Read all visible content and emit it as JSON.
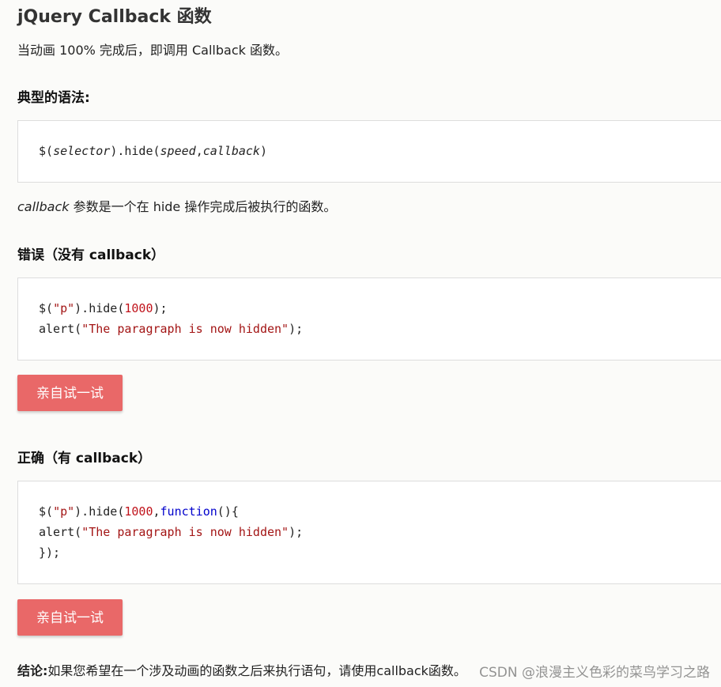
{
  "title": "jQuery Callback 函数",
  "intro": "当动画 100% 完成后，即调用 Callback 函数。",
  "syntax_heading": "典型的语法:",
  "syntax_code": {
    "prefix": "$(",
    "selector": "selector",
    "mid": ").hide(",
    "speed": "speed",
    "comma": ",",
    "callback": "callback",
    "suffix": ")"
  },
  "callback_desc": {
    "term": "callback",
    "rest": " 参数是一个在 hide 操作完成后被执行的函数。"
  },
  "wrong_heading": "错误（没有 callback）",
  "wrong_code": {
    "l1_a": "$(",
    "l1_str": "\"p\"",
    "l1_b": ").hide(",
    "l1_num": "1000",
    "l1_c": ");",
    "l2_a": "alert(",
    "l2_str": "\"The paragraph is now hidden\"",
    "l2_b": ");"
  },
  "try_button_1": "亲自试一试",
  "right_heading": "正确（有 callback）",
  "right_code": {
    "l1_a": "$(",
    "l1_str": "\"p\"",
    "l1_b": ").hide(",
    "l1_num": "1000",
    "l1_comma": ",",
    "l1_kw": "function",
    "l1_c": "(){",
    "l2_a": "alert(",
    "l2_str": "\"The paragraph is now hidden\"",
    "l2_b": ");",
    "l3": "});"
  },
  "try_button_2": "亲自试一试",
  "conclusion": {
    "label": "结论:",
    "text": "如果您希望在一个涉及动画的函数之后来执行语句，请使用callback函数。"
  },
  "watermark": "CSDN @浪漫主义色彩的菜鸟学习之路"
}
